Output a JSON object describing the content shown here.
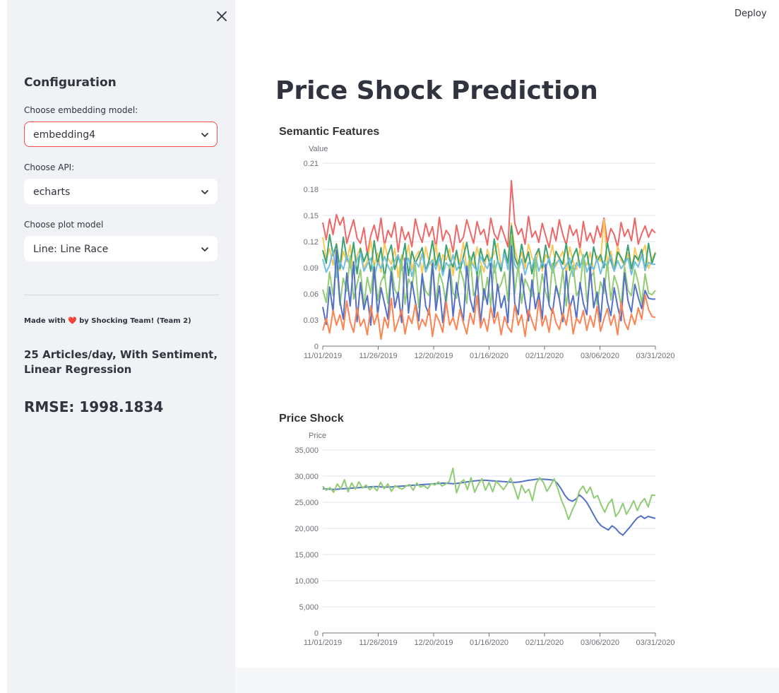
{
  "sidebar": {
    "title": "Configuration",
    "embedding": {
      "label": "Choose embedding model:",
      "value": "embedding4"
    },
    "api": {
      "label": "Choose API:",
      "value": "echarts"
    },
    "plot": {
      "label": "Choose plot model",
      "value": "Line: Line Race"
    },
    "made_with_prefix": "Made with",
    "made_with_heart": "❤️",
    "made_with_suffix": "by Shocking Team! (Team 2)",
    "description": "25 Articles/day, With Sentiment, Linear Regression",
    "rmse": "RMSE: 1998.1834"
  },
  "header": {
    "deploy_label": "Deploy"
  },
  "main": {
    "title": "Price Shock Prediction"
  },
  "chart_data": [
    {
      "type": "line",
      "title": "Semantic Features",
      "ylabel": "Value",
      "xlabel": "",
      "ylim": [
        0,
        0.21
      ],
      "yticks": [
        "0",
        "0.03",
        "0.06",
        "0.09",
        "0.12",
        "0.15",
        "0.18",
        "0.21"
      ],
      "xticks": [
        "11/01/2019",
        "11/26/2019",
        "12/20/2019",
        "01/16/2020",
        "02/11/2020",
        "03/06/2020",
        "03/31/2020"
      ],
      "colors": [
        "#ee6666",
        "#fac858",
        "#3ba272",
        "#73c0de",
        "#91cc75",
        "#5470c6",
        "#fc8452"
      ],
      "series_values": [
        [
          0.142,
          0.122,
          0.146,
          0.128,
          0.151,
          0.139,
          0.148,
          0.118,
          0.132,
          0.145,
          0.124,
          0.118,
          0.136,
          0.105,
          0.127,
          0.139,
          0.121,
          0.147,
          0.115,
          0.133,
          0.125,
          0.142,
          0.108,
          0.137,
          0.122,
          0.131,
          0.114,
          0.146,
          0.129,
          0.119,
          0.141,
          0.126,
          0.137,
          0.112,
          0.148,
          0.121,
          0.133,
          0.127,
          0.108,
          0.139,
          0.119,
          0.125,
          0.145,
          0.131,
          0.118,
          0.143,
          0.128,
          0.134,
          0.116,
          0.147,
          0.129,
          0.122,
          0.138,
          0.126,
          0.114,
          0.19,
          0.141,
          0.128,
          0.135,
          0.117,
          0.149,
          0.125,
          0.132,
          0.119,
          0.141,
          0.127,
          0.113,
          0.136,
          0.121,
          0.145,
          0.128,
          0.116,
          0.139,
          0.127,
          0.134,
          0.112,
          0.143,
          0.121,
          0.13,
          0.118,
          0.138,
          0.125,
          0.147,
          0.119,
          0.135,
          0.128,
          0.113,
          0.142,
          0.126,
          0.134,
          0.121,
          0.147,
          0.117,
          0.129,
          0.138,
          0.125,
          0.134,
          0.13
        ],
        [
          0.125,
          0.1,
          0.112,
          0.093,
          0.118,
          0.087,
          0.109,
          0.097,
          0.116,
          0.082,
          0.104,
          0.113,
          0.089,
          0.098,
          0.121,
          0.092,
          0.107,
          0.085,
          0.118,
          0.101,
          0.094,
          0.112,
          0.079,
          0.105,
          0.096,
          0.116,
          0.088,
          0.102,
          0.109,
          0.083,
          0.114,
          0.097,
          0.091,
          0.117,
          0.086,
          0.105,
          0.099,
          0.112,
          0.081,
          0.108,
          0.095,
          0.119,
          0.088,
          0.103,
          0.092,
          0.114,
          0.097,
          0.085,
          0.111,
          0.099,
          0.107,
          0.118,
          0.091,
          0.104,
          0.096,
          0.141,
          0.112,
          0.095,
          0.108,
          0.089,
          0.117,
          0.102,
          0.093,
          0.111,
          0.086,
          0.105,
          0.098,
          0.116,
          0.092,
          0.101,
          0.109,
          0.083,
          0.114,
          0.097,
          0.088,
          0.112,
          0.1,
          0.093,
          0.108,
          0.086,
          0.104,
          0.097,
          0.145,
          0.096,
          0.109,
          0.088,
          0.115,
          0.099,
          0.092,
          0.107,
          0.084,
          0.113,
          0.097,
          0.105,
          0.116,
          0.089,
          0.1,
          0.108
        ],
        [
          0.11,
          0.095,
          0.128,
          0.104,
          0.117,
          0.089,
          0.125,
          0.101,
          0.093,
          0.119,
          0.083,
          0.112,
          0.097,
          0.108,
          0.086,
          0.121,
          0.094,
          0.113,
          0.078,
          0.105,
          0.116,
          0.088,
          0.102,
          0.096,
          0.118,
          0.081,
          0.109,
          0.095,
          0.104,
          0.113,
          0.087,
          0.098,
          0.121,
          0.093,
          0.107,
          0.084,
          0.116,
          0.099,
          0.091,
          0.11,
          0.086,
          0.103,
          0.119,
          0.094,
          0.108,
          0.081,
          0.112,
          0.097,
          0.105,
          0.089,
          0.123,
          0.099,
          0.086,
          0.111,
          0.095,
          0.138,
          0.102,
          0.091,
          0.117,
          0.096,
          0.108,
          0.083,
          0.104,
          0.112,
          0.09,
          0.116,
          0.097,
          0.085,
          0.109,
          0.101,
          0.094,
          0.118,
          0.087,
          0.103,
          0.112,
          0.092,
          0.099,
          0.108,
          0.084,
          0.114,
          0.097,
          0.105,
          0.09,
          0.119,
          0.098,
          0.086,
          0.108,
          0.102,
          0.094,
          0.116,
          0.089,
          0.104,
          0.099,
          0.111,
          0.087,
          0.118,
          0.095,
          0.107
        ],
        [
          0.1,
          0.085,
          0.093,
          0.11,
          0.079,
          0.097,
          0.088,
          0.104,
          0.091,
          0.083,
          0.099,
          0.107,
          0.086,
          0.094,
          0.101,
          0.078,
          0.096,
          0.089,
          0.103,
          0.092,
          0.084,
          0.098,
          0.105,
          0.087,
          0.093,
          0.101,
          0.08,
          0.097,
          0.091,
          0.106,
          0.085,
          0.094,
          0.099,
          0.088,
          0.102,
          0.081,
          0.096,
          0.09,
          0.105,
          0.087,
          0.094,
          0.1,
          0.082,
          0.097,
          0.092,
          0.086,
          0.103,
          0.095,
          0.089,
          0.101,
          0.084,
          0.098,
          0.091,
          0.106,
          0.088,
          0.114,
          0.093,
          0.087,
          0.1,
          0.082,
          0.096,
          0.091,
          0.104,
          0.086,
          0.097,
          0.089,
          0.102,
          0.084,
          0.095,
          0.099,
          0.087,
          0.093,
          0.101,
          0.08,
          0.096,
          0.09,
          0.105,
          0.085,
          0.094,
          0.088,
          0.1,
          0.083,
          0.097,
          0.091,
          0.104,
          0.086,
          0.098,
          0.089,
          0.095,
          0.101,
          0.082,
          0.097,
          0.091,
          0.104,
          0.088,
          0.096,
          0.094,
          0.094
        ],
        [
          0.065,
          0.05,
          0.085,
          0.058,
          0.097,
          0.047,
          0.078,
          0.063,
          0.104,
          0.054,
          0.071,
          0.088,
          0.046,
          0.079,
          0.061,
          0.095,
          0.052,
          0.074,
          0.083,
          0.049,
          0.091,
          0.065,
          0.057,
          0.102,
          0.048,
          0.077,
          0.069,
          0.093,
          0.044,
          0.081,
          0.063,
          0.058,
          0.097,
          0.051,
          0.084,
          0.072,
          0.047,
          0.094,
          0.061,
          0.055,
          0.089,
          0.076,
          0.049,
          0.103,
          0.058,
          0.067,
          0.092,
          0.053,
          0.079,
          0.046,
          0.098,
          0.064,
          0.071,
          0.085,
          0.052,
          0.128,
          0.061,
          0.094,
          0.049,
          0.077,
          0.068,
          0.057,
          0.101,
          0.054,
          0.083,
          0.062,
          0.049,
          0.095,
          0.071,
          0.056,
          0.087,
          0.046,
          0.079,
          0.093,
          0.058,
          0.066,
          0.104,
          0.051,
          0.078,
          0.085,
          0.048,
          0.074,
          0.061,
          0.097,
          0.053,
          0.081,
          0.069,
          0.046,
          0.091,
          0.064,
          0.058,
          0.088,
          0.073,
          0.049,
          0.083,
          0.061,
          0.059,
          0.064
        ],
        [
          0.045,
          0.025,
          0.068,
          0.039,
          0.11,
          0.052,
          0.031,
          0.084,
          0.046,
          0.097,
          0.028,
          0.073,
          0.042,
          0.058,
          0.024,
          0.091,
          0.036,
          0.067,
          0.049,
          0.031,
          0.085,
          0.044,
          0.062,
          0.027,
          0.101,
          0.038,
          0.074,
          0.051,
          0.029,
          0.083,
          0.046,
          0.036,
          0.095,
          0.041,
          0.069,
          0.027,
          0.058,
          0.088,
          0.034,
          0.073,
          0.047,
          0.029,
          0.092,
          0.054,
          0.039,
          0.081,
          0.026,
          0.066,
          0.048,
          0.095,
          0.033,
          0.071,
          0.044,
          0.058,
          0.027,
          0.115,
          0.049,
          0.036,
          0.083,
          0.052,
          0.029,
          0.076,
          0.043,
          0.061,
          0.031,
          0.094,
          0.047,
          0.038,
          0.069,
          0.054,
          0.028,
          0.086,
          0.043,
          0.058,
          0.031,
          0.073,
          0.049,
          0.036,
          0.091,
          0.044,
          0.062,
          0.028,
          0.078,
          0.051,
          0.035,
          0.067,
          0.045,
          0.029,
          0.084,
          0.052,
          0.039,
          0.071,
          0.056,
          0.043,
          0.064,
          0.055,
          0.054,
          0.054
        ],
        [
          0.018,
          0.032,
          0.015,
          0.041,
          0.024,
          0.036,
          0.019,
          0.052,
          0.028,
          0.016,
          0.044,
          0.023,
          0.031,
          0.013,
          0.046,
          0.025,
          0.038,
          0.008,
          0.033,
          0.021,
          0.055,
          0.017,
          0.029,
          0.042,
          0.014,
          0.035,
          0.026,
          0.048,
          0.019,
          0.031,
          0.023,
          0.044,
          0.011,
          0.037,
          0.028,
          0.016,
          0.051,
          0.024,
          0.033,
          0.019,
          0.042,
          0.027,
          0.014,
          0.038,
          0.025,
          0.058,
          0.021,
          0.032,
          0.017,
          0.045,
          0.026,
          0.039,
          0.013,
          0.034,
          0.022,
          0.016,
          0.047,
          0.024,
          0.036,
          0.011,
          0.042,
          0.029,
          0.018,
          0.053,
          0.023,
          0.035,
          0.016,
          0.044,
          0.027,
          0.019,
          0.038,
          0.024,
          0.049,
          0.014,
          0.032,
          0.026,
          0.041,
          0.018,
          0.035,
          0.022,
          0.046,
          0.017,
          0.031,
          0.043,
          0.024,
          0.036,
          0.013,
          0.051,
          0.028,
          0.019,
          0.037,
          0.025,
          0.044,
          0.031,
          0.059,
          0.042,
          0.034,
          0.033
        ]
      ]
    },
    {
      "type": "line",
      "title": "Price Shock",
      "ylabel": "Price",
      "xlabel": "",
      "ylim": [
        0,
        35000
      ],
      "yticks": [
        "0",
        "5,000",
        "10,000",
        "15,000",
        "20,000",
        "25,000",
        "30,000",
        "35,000"
      ],
      "xticks": [
        "11/01/2019",
        "11/26/2019",
        "12/20/2019",
        "01/16/2020",
        "02/11/2020",
        "03/06/2020",
        "03/31/2020"
      ],
      "colors": [
        "#5470c6",
        "#91cc75"
      ],
      "series_values": [
        [
          27600,
          27550,
          27500,
          27450,
          27500,
          27550,
          27600,
          27650,
          27700,
          27750,
          27800,
          27850,
          27900,
          27950,
          28000,
          28000,
          27950,
          27900,
          27900,
          27950,
          28000,
          28050,
          28100,
          28150,
          28200,
          28250,
          28300,
          28350,
          28400,
          28450,
          28500,
          28550,
          28600,
          28650,
          28650,
          28600,
          28550,
          28600,
          28700,
          28800,
          28900,
          29000,
          29100,
          29150,
          29200,
          29200,
          29150,
          29100,
          29050,
          29000,
          28950,
          28900,
          28850,
          28800,
          28850,
          28950,
          29100,
          29200,
          29300,
          29400,
          29450,
          29400,
          29350,
          29300,
          29200,
          28500,
          27500,
          26300,
          25500,
          25200,
          25600,
          26400,
          25800,
          25000,
          23800,
          22500,
          21300,
          20500,
          20100,
          19700,
          20500,
          20000,
          19200,
          18700,
          19500,
          20300,
          21200,
          22000,
          22400,
          21900,
          22300,
          22100,
          21900
        ],
        [
          28100,
          27300,
          27800,
          26900,
          28500,
          27600,
          29300,
          27000,
          28700,
          27500,
          28900,
          27700,
          28300,
          27400,
          28000,
          27200,
          28800,
          27600,
          28500,
          27100,
          28200,
          27800,
          27500,
          28100,
          28400,
          27300,
          28700,
          27900,
          28200,
          27600,
          28600,
          28300,
          28900,
          28100,
          28500,
          29000,
          31500,
          26800,
          28700,
          29300,
          27400,
          29700,
          26900,
          28400,
          29500,
          27300,
          28800,
          27000,
          29100,
          28200,
          27400,
          28500,
          29600,
          27800,
          25600,
          28300,
          26800,
          27500,
          25300,
          28600,
          29700,
          28800,
          27100,
          28200,
          29500,
          27600,
          25400,
          23800,
          21700,
          23500,
          24900,
          27200,
          28100,
          26700,
          27900,
          25800,
          26300,
          24500,
          23100,
          24700,
          25600,
          22300,
          23200,
          24800,
          22700,
          23900,
          25300,
          23400,
          24900,
          25700,
          24100,
          26400,
          26300
        ]
      ]
    }
  ]
}
